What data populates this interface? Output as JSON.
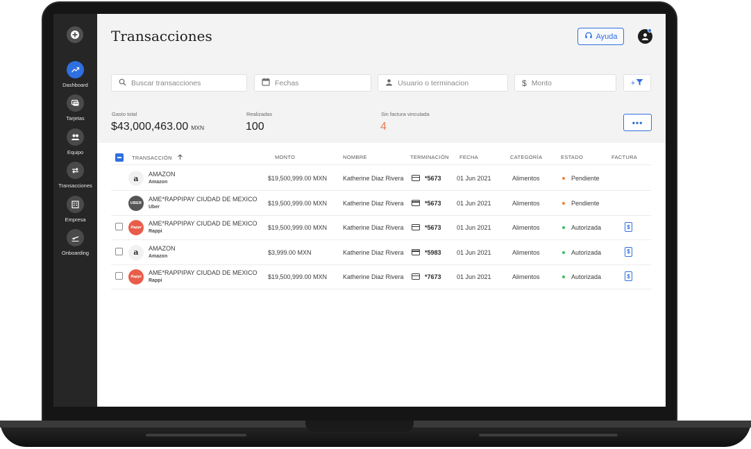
{
  "sidebar": {
    "items": [
      {
        "label": "Dashboard",
        "icon": "trend-up-icon",
        "active": true
      },
      {
        "label": "Tarjetas",
        "icon": "cards-icon",
        "active": false
      },
      {
        "label": "Equipo",
        "icon": "team-icon",
        "active": false
      },
      {
        "label": "Transacciones",
        "icon": "transfer-icon",
        "active": false
      },
      {
        "label": "Empresa",
        "icon": "building-icon",
        "active": false
      },
      {
        "label": "Onboarding",
        "icon": "plane-icon",
        "active": false
      }
    ]
  },
  "header": {
    "title": "Transacciones",
    "help_label": "Ayuda"
  },
  "filters": {
    "search_placeholder": "Buscar transacciones",
    "dates_placeholder": "Fechas",
    "user_placeholder": "Usuario o terminacion",
    "amount_placeholder": "Monto",
    "filter_button_label": "+"
  },
  "stats": {
    "total_label": "Gasto total",
    "total_value": "$43,000,463.00",
    "total_currency": "MXN",
    "done_label": "Realizadas",
    "done_value": "100",
    "no_invoice_label": "Sin factura vinculada",
    "no_invoice_value": "4",
    "more_label": "•••"
  },
  "table": {
    "columns": [
      "TRANSACCIÓN",
      "MONTO",
      "NOMBRE",
      "TERMINACIÓN",
      "FECHA",
      "CATEGORÍA",
      "ESTADO",
      "FACTURA"
    ],
    "rows": [
      {
        "merchant": "AMAZON",
        "sub": "Amazon",
        "logo": "a",
        "amount": "$19,500,999.00 MXN",
        "name": "Katherine Diaz Rivera",
        "term": "*5673",
        "date": "01 Jun 2021",
        "category": "Alimentos",
        "status": "Pendiente",
        "status_color": "#e8843c",
        "invoice": false,
        "checkbox": false
      },
      {
        "merchant": "AME*RAPPIPAY CIUDAD DE MEXICO",
        "sub": "Uber",
        "logo": "UBER",
        "amount": "$19,500,999.00 MXN",
        "name": "Katherine Diaz Rivera",
        "term": "*5673",
        "date": "01 Jun 2021",
        "category": "Alimentos",
        "status": "Pendiente",
        "status_color": "#e8843c",
        "invoice": false,
        "checkbox": false
      },
      {
        "merchant": "AME*RAPPIPAY CIUDAD DE MEXICO",
        "sub": "Rappi",
        "logo": "Rappi",
        "amount": "$19,500,999.00 MXN",
        "name": "Katherine Diaz Rivera",
        "term": "*5673",
        "date": "01 Jun 2021",
        "category": "Alimentos",
        "status": "Autorizada",
        "status_color": "#3dbb5a",
        "invoice": true,
        "checkbox": true
      },
      {
        "merchant": "AMAZON",
        "sub": "Amazon",
        "logo": "a",
        "amount": "$3,999.00 MXN",
        "name": "Katherine Diaz Rivera",
        "term": "*5983",
        "date": "01 Jun 2021",
        "category": "Alimentos",
        "status": "Autorizada",
        "status_color": "#3dbb5a",
        "invoice": true,
        "checkbox": true
      },
      {
        "merchant": "AME*RAPPIPAY CIUDAD DE MEXICO",
        "sub": "Rappi",
        "logo": "Rappi",
        "amount": "$19,500,999.00 MXN",
        "name": "Katherine Diaz Rivera",
        "term": "*7673",
        "date": "01 Jun 2021",
        "category": "Alimentos",
        "status": "Autorizada",
        "status_color": "#3dbb5a",
        "invoice": true,
        "checkbox": true
      }
    ]
  },
  "colors": {
    "accent": "#2f6fe0",
    "pending": "#e8843c",
    "authorized": "#3dbb5a",
    "alert": "#e87b4f"
  }
}
